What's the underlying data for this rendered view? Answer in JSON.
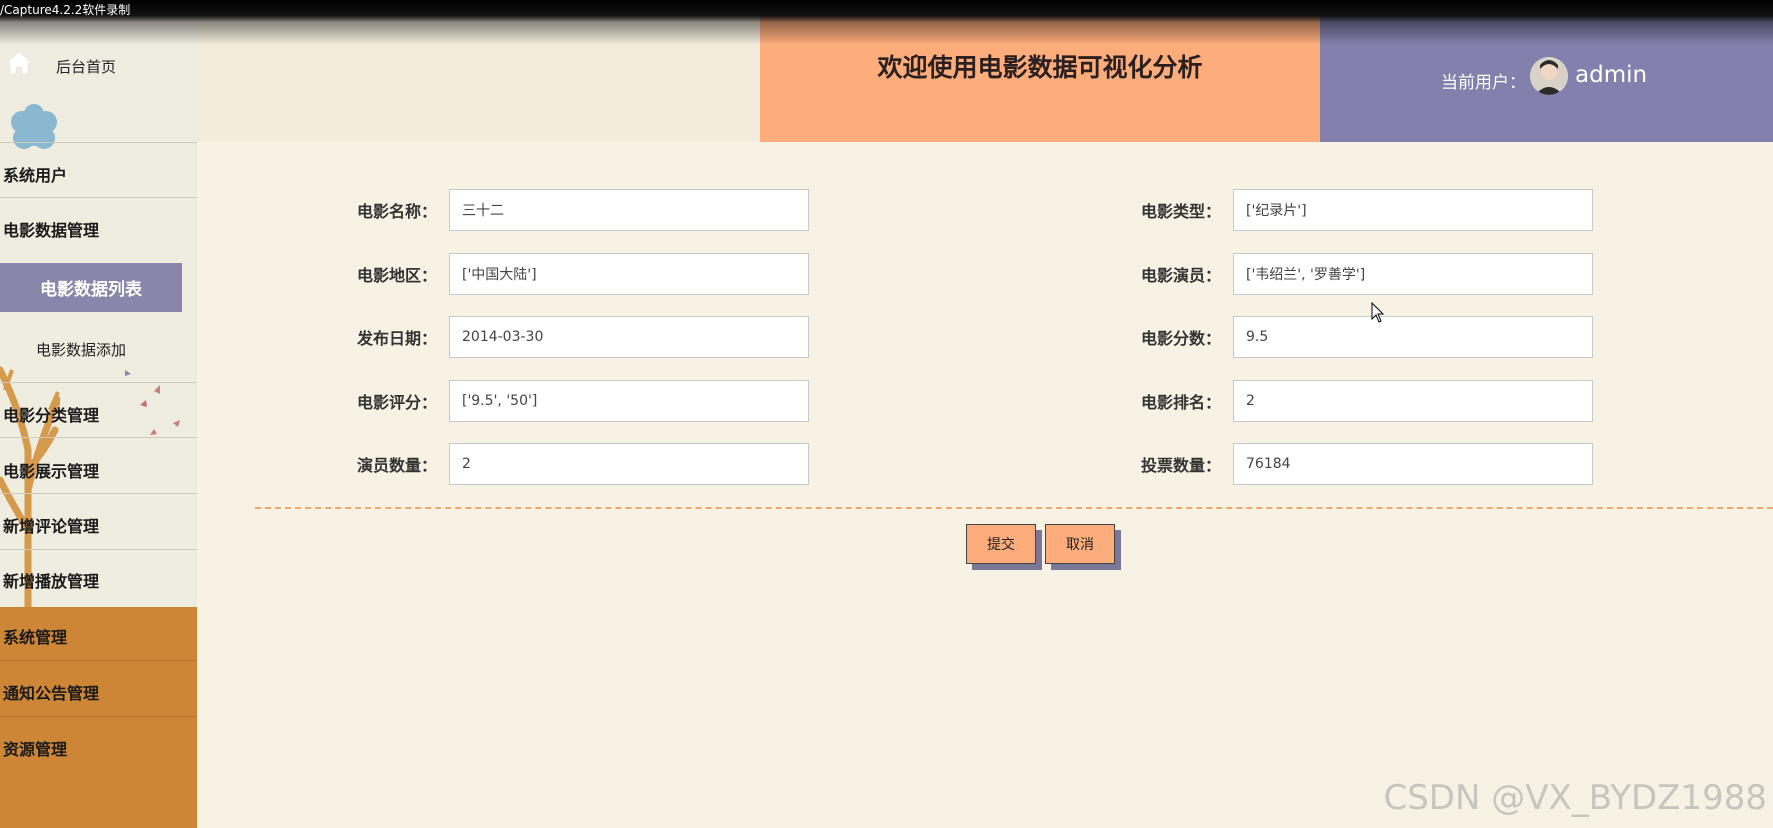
{
  "recorder": {
    "caption": "/Capture4.2.2软件录制"
  },
  "sidebar": {
    "home_label": "后台首页",
    "items": [
      {
        "label": "系统用户"
      },
      {
        "label": "电影数据管理"
      },
      {
        "label": "电影数据列表",
        "active": true
      },
      {
        "label": "电影数据添加"
      },
      {
        "label": "电影分类管理"
      },
      {
        "label": "电影展示管理"
      },
      {
        "label": "新增评论管理"
      },
      {
        "label": "新增播放管理"
      },
      {
        "label": "系统管理"
      },
      {
        "label": "通知公告管理"
      },
      {
        "label": "资源管理"
      }
    ]
  },
  "header": {
    "title": "欢迎使用电影数据可视化分析",
    "user_label": "当前用户：",
    "username": "admin"
  },
  "form": {
    "fields": [
      {
        "label": "电影名称：",
        "value": "三十二"
      },
      {
        "label": "电影类型：",
        "value": "['纪录片']"
      },
      {
        "label": "电影地区：",
        "value": "['中国大陆']"
      },
      {
        "label": "电影演员：",
        "value": "['韦绍兰', '罗善学']"
      },
      {
        "label": "发布日期：",
        "value": "2014-03-30"
      },
      {
        "label": "电影分数：",
        "value": "9.5"
      },
      {
        "label": "电影评分：",
        "value": "['9.5', '50']"
      },
      {
        "label": "电影排名：",
        "value": "2"
      },
      {
        "label": "演员数量：",
        "value": "2"
      },
      {
        "label": "投票数量：",
        "value": "76184"
      }
    ],
    "submit_label": "提交",
    "cancel_label": "取消"
  },
  "watermark": "CSDN @VX_BYDZ1988",
  "colors": {
    "header_title_bg": "#fdad7c",
    "header_user_bg": "#8380ad",
    "sidebar_active_bg": "#8a86ab",
    "sidebar_bottom_bg": "#cd8536",
    "page_bg": "#f8f2e5"
  }
}
